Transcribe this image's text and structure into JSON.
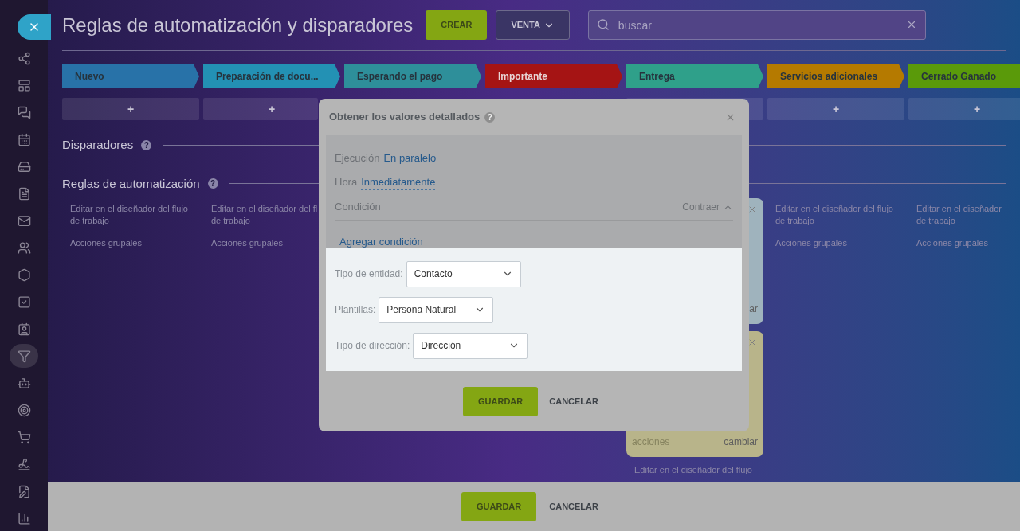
{
  "sidebar": {
    "items": [
      {
        "selected": false
      },
      {
        "selected": false
      },
      {
        "selected": false
      },
      {
        "selected": false
      },
      {
        "selected": false
      },
      {
        "selected": false
      },
      {
        "selected": false
      },
      {
        "selected": false
      },
      {
        "selected": false
      },
      {
        "selected": false
      },
      {
        "selected": false
      },
      {
        "selected": true
      },
      {
        "selected": false
      },
      {
        "selected": false
      },
      {
        "selected": false
      },
      {
        "selected": false
      },
      {
        "selected": false
      },
      {
        "selected": false
      }
    ]
  },
  "header": {
    "title": "Reglas de automatización y disparadores",
    "create_button": "CREAR",
    "category_button": "VENTA",
    "search": {
      "placeholder": "buscar"
    }
  },
  "stages": [
    {
      "label": "Nuevo",
      "color": "#2872a8"
    },
    {
      "label": "Preparación de docu...",
      "color": "#2391b4"
    },
    {
      "label": "Esperando el pago",
      "color": "#2e8f9a"
    },
    {
      "label": "Importante",
      "color": "#a51414"
    },
    {
      "label": "Entrega",
      "color": "#2fa08a"
    },
    {
      "label": "Servicios adicionales",
      "color": "#b57a00"
    },
    {
      "label": "Cerrado Ganado",
      "color": "#5a9a0a"
    }
  ],
  "triggers_title": "Disparadores",
  "triggers_help": "?",
  "rules_title": "Reglas de automatización",
  "rules_help": "?",
  "columns": [
    {
      "add_button": "+",
      "items": [
        {
          "kind": "text",
          "lines": [
            "Editar en el diseñador del flujo",
            "de trabajo"
          ]
        },
        {
          "kind": "text",
          "lines": [
            "Acciones grupales"
          ]
        }
      ]
    },
    {
      "add_button": "+",
      "items": [
        {
          "kind": "text",
          "lines": [
            "Editar en el diseñador del fl",
            "de trabajo"
          ]
        },
        {
          "kind": "text",
          "lines": [
            "Acciones grupales"
          ]
        }
      ]
    },
    {},
    {},
    {
      "items": [
        {
          "kind": "card",
          "color": "#9fb3bd",
          "footer_right": "ar"
        },
        {
          "kind": "card",
          "color": "#b8b48a",
          "footer_left": "acciones",
          "footer_right": "cambiar"
        },
        {
          "kind": "text",
          "lines": [
            "Editar en el diseñador del flujo"
          ]
        }
      ]
    },
    {
      "add_button": "+",
      "items": [
        {
          "kind": "text",
          "lines": [
            "Editar en el diseñador del flujo",
            "de trabajo"
          ]
        },
        {
          "kind": "text",
          "lines": [
            "Acciones grupales"
          ]
        }
      ]
    },
    {
      "add_button": "+",
      "items": [
        {
          "kind": "text",
          "lines": [
            "Editar en el diseñador",
            "de trabajo"
          ]
        },
        {
          "kind": "text",
          "lines": [
            "Acciones grupales"
          ]
        }
      ]
    }
  ],
  "dialog": {
    "title": "Obtener los valores detallados",
    "help": "?",
    "fields": [
      {
        "label": "Ejecución",
        "value": "En paralelo"
      },
      {
        "label": "Hora",
        "value": "Inmediatamente"
      }
    ],
    "condition": {
      "label": "Condición",
      "toggle": "Contraer",
      "expanded": true
    },
    "add_condition": "Agregar condición",
    "selects": [
      {
        "label": "Tipo de entidad:",
        "value": "Contacto"
      },
      {
        "label": "Plantillas:",
        "value": "Persona Natural"
      },
      {
        "label": "Tipo de dirección:",
        "value": "Dirección"
      }
    ],
    "save": "GUARDAR",
    "cancel": "CANCELAR"
  },
  "footer": {
    "save": "GUARDAR",
    "cancel": "CANCELAR"
  }
}
